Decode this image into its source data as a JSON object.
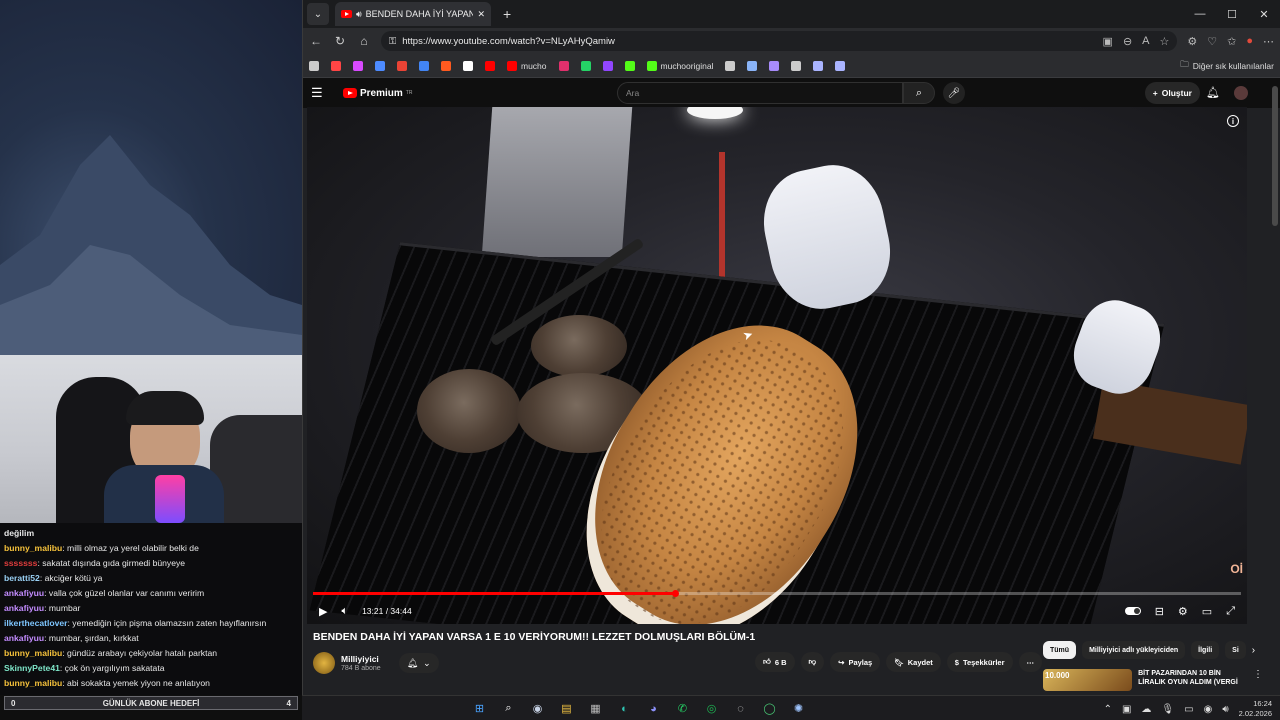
{
  "chat": {
    "messages": [
      {
        "user": "",
        "user_color": "#ffffff",
        "text": "değilim"
      },
      {
        "user": "bunny_malibu",
        "user_color": "#f6c23b",
        "text": ": milli olmaz ya yerel olabilir belki de"
      },
      {
        "user": "sssssss",
        "user_color": "#e23d3d",
        "text": ": sakatat dışında gıda girmedi bünyeye"
      },
      {
        "user": "beratti52",
        "user_color": "#9ad1f5",
        "text": ": akciğer kötü ya"
      },
      {
        "user": "ankafiyuu",
        "user_color": "#c38cff",
        "text": ": valla çok güzel olanlar var canımı veririm"
      },
      {
        "user": "ankafiyuu",
        "user_color": "#c38cff",
        "text": ": mumbar"
      },
      {
        "user": "ilkerthecatlover",
        "user_color": "#7ec6ff",
        "text": ": yemediğin için pişma olamazsın zaten hayıflanırsın"
      },
      {
        "user": "ankafiyuu",
        "user_color": "#c38cff",
        "text": ": mumbar, şırdan, kırkkat"
      },
      {
        "user": "bunny_malibu",
        "user_color": "#f6c23b",
        "text": ": gündüz arabayı çekiyolar hatalı parktan"
      },
      {
        "user": "SkinnyPete41",
        "user_color": "#7fe7c9",
        "text": ": çok ön yargılıyım sakatata"
      },
      {
        "user": "bunny_malibu",
        "user_color": "#f6c23b",
        "text": ": abi sokakta yemek yiyon ne anlatıyon"
      }
    ],
    "goal": {
      "left": "0",
      "label": "GÜNLÜK ABONE HEDEFİ",
      "right": "4"
    }
  },
  "browser": {
    "tab_title": "BENDEN DAHA İYİ YAPAN VA",
    "url": "https://www.youtube.com/watch?v=NLyAHyQamiw",
    "bookmarks": [
      {
        "label": "",
        "color": "#cccccc"
      },
      {
        "label": "",
        "color": "#ff4545"
      },
      {
        "label": "",
        "color": "#d84aff"
      },
      {
        "label": "",
        "color": "#4d8bff"
      },
      {
        "label": "",
        "color": "#ea4335"
      },
      {
        "label": "",
        "color": "#4285f4"
      },
      {
        "label": "",
        "color": "#ff5a1f"
      },
      {
        "label": "",
        "color": "#ffffff"
      },
      {
        "label": "",
        "color": "#ff0000"
      },
      {
        "label": "mucho",
        "color": "#ff0000"
      },
      {
        "label": "",
        "color": "#e1306c"
      },
      {
        "label": "",
        "color": "#25d366"
      },
      {
        "label": "",
        "color": "#9146ff"
      },
      {
        "label": "",
        "color": "#53fc18"
      },
      {
        "label": "muchooriginal",
        "color": "#53fc18"
      },
      {
        "label": "",
        "color": "#cccccc"
      },
      {
        "label": "",
        "color": "#8ab4f8"
      },
      {
        "label": "",
        "color": "#a78bfa"
      },
      {
        "label": "",
        "color": "#cccccc"
      },
      {
        "label": "",
        "color": "#aab4ff"
      },
      {
        "label": "",
        "color": "#aab4ff"
      }
    ],
    "bookmarks_other": "Diğer sık kullanılanlar"
  },
  "youtube": {
    "logo": "Premium",
    "logo_sup": "TR",
    "search_placeholder": "Ara",
    "create_label": "Oluştur",
    "time": "13:21 / 34:44",
    "progress": 0.39,
    "video_title": "BENDEN DAHA İYİ YAPAN VARSA 1 E 10 VERİYORUM!! LEZZET DOLMUŞLARI BÖLÜM-1",
    "channel": "Milliyiyici",
    "subscribers": "784 B abone",
    "likes": "6 B",
    "share": "Paylaş",
    "save": "Kaydet",
    "thanks": "Teşekkürler",
    "chips": [
      "Tümü",
      "Milliyiyici adlı yükleyiciden",
      "İlgili",
      "Si"
    ],
    "rec_title": "BİT PAZARINDAN 10 BİN LİRALIK OYUN ALDIM (VERGİ",
    "rec_thumb_text": "10.000",
    "watermark": "Oİ"
  },
  "taskbar": {
    "time": "16:24",
    "date": "2.02.2026"
  }
}
